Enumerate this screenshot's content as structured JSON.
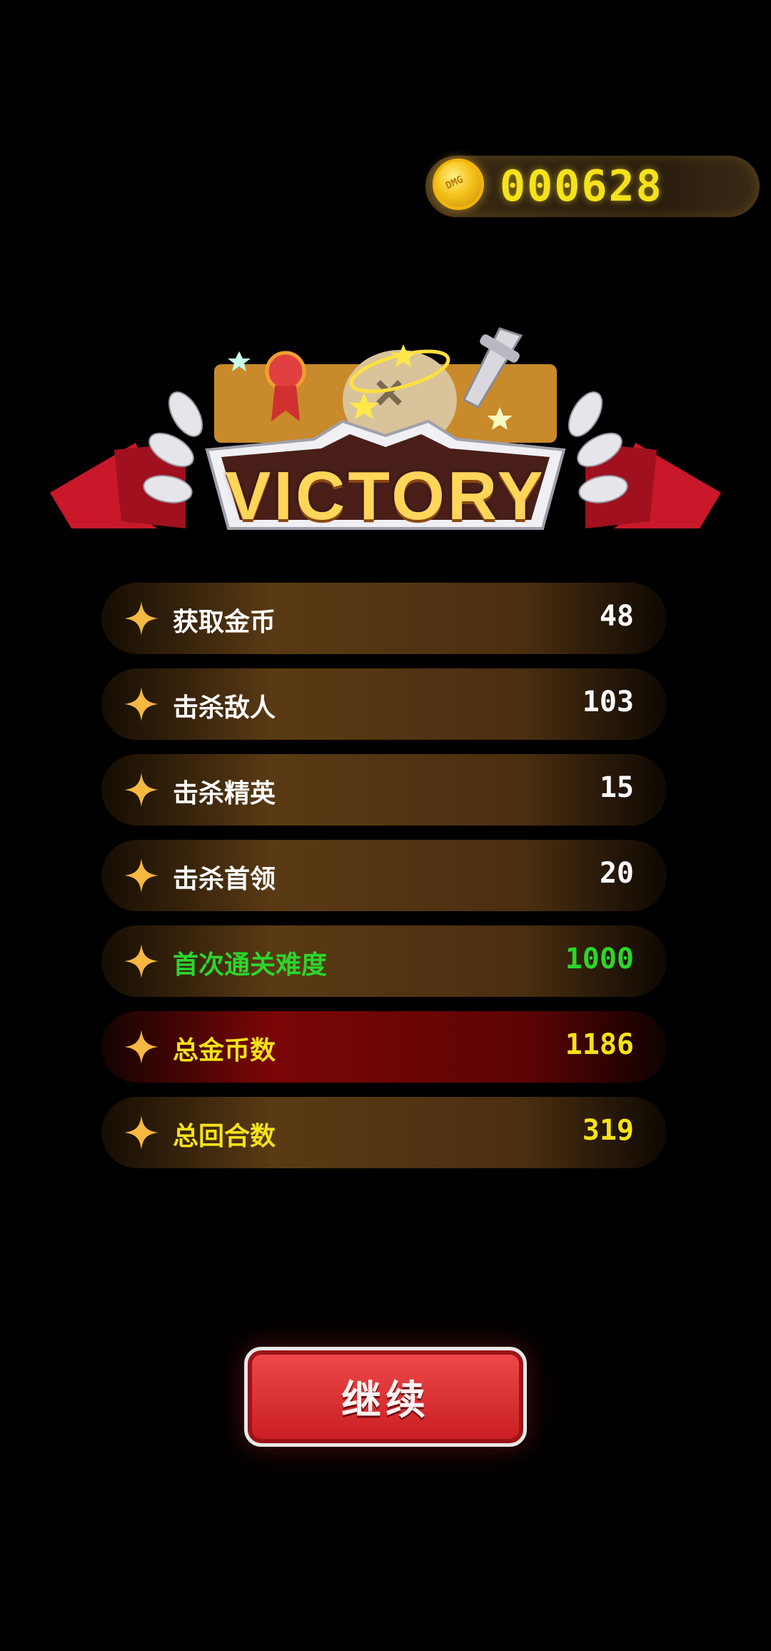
{
  "header": {
    "coins": "000628",
    "coin_icon": "gold-coin-icon"
  },
  "banner": {
    "title": "VICTORY"
  },
  "stats": [
    {
      "label": "获取金币",
      "value": "48",
      "label_color": "#ffffff",
      "value_color": "#ffffff",
      "bg": "brown"
    },
    {
      "label": "击杀敌人",
      "value": "103",
      "label_color": "#ffffff",
      "value_color": "#ffffff",
      "bg": "brown"
    },
    {
      "label": "击杀精英",
      "value": "15",
      "label_color": "#ffffff",
      "value_color": "#ffffff",
      "bg": "brown"
    },
    {
      "label": "击杀首领",
      "value": "20",
      "label_color": "#ffffff",
      "value_color": "#ffffff",
      "bg": "brown"
    },
    {
      "label": "首次通关难度",
      "value": "1000",
      "label_color": "#2cd62c",
      "value_color": "#2cd62c",
      "bg": "brown"
    },
    {
      "label": "总金币数",
      "value": "1186",
      "label_color": "#f6e21a",
      "value_color": "#f6e21a",
      "bg": "red"
    },
    {
      "label": "总回合数",
      "value": "319",
      "label_color": "#f6e21a",
      "value_color": "#f6e21a",
      "bg": "brown"
    }
  ],
  "continue_button": {
    "label": "继续"
  }
}
